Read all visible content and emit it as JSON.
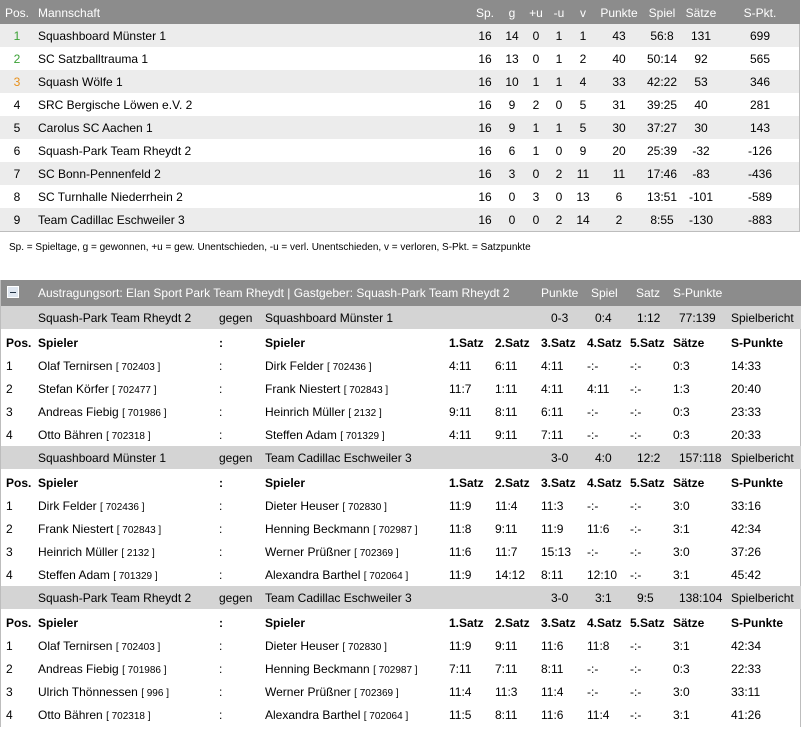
{
  "standings": {
    "headers": {
      "pos": "Pos.",
      "team": "Mannschaft",
      "sp": "Sp.",
      "g": "g",
      "pu": "+u",
      "mu": "-u",
      "v": "v",
      "punkte": "Punkte",
      "spiel": "Spiel",
      "saetze": "Sätze",
      "spkt": "S-Pkt."
    },
    "rows": [
      {
        "pos": "1",
        "team": "Squashboard Münster 1",
        "sp": "16",
        "g": "14",
        "pu": "0",
        "mu": "1",
        "v": "1",
        "punkte": "43",
        "spiel": "56:8",
        "saetze": "131",
        "spkt": "699"
      },
      {
        "pos": "2",
        "team": "SC Satzballtrauma 1",
        "sp": "16",
        "g": "13",
        "pu": "0",
        "mu": "1",
        "v": "2",
        "punkte": "40",
        "spiel": "50:14",
        "saetze": "92",
        "spkt": "565"
      },
      {
        "pos": "3",
        "team": "Squash Wölfe 1",
        "sp": "16",
        "g": "10",
        "pu": "1",
        "mu": "1",
        "v": "4",
        "punkte": "33",
        "spiel": "42:22",
        "saetze": "53",
        "spkt": "346"
      },
      {
        "pos": "4",
        "team": "SRC Bergische Löwen e.V. 2",
        "sp": "16",
        "g": "9",
        "pu": "2",
        "mu": "0",
        "v": "5",
        "punkte": "31",
        "spiel": "39:25",
        "saetze": "40",
        "spkt": "281"
      },
      {
        "pos": "5",
        "team": "Carolus SC Aachen 1",
        "sp": "16",
        "g": "9",
        "pu": "1",
        "mu": "1",
        "v": "5",
        "punkte": "30",
        "spiel": "37:27",
        "saetze": "30",
        "spkt": "143"
      },
      {
        "pos": "6",
        "team": "Squash-Park Team Rheydt 2",
        "sp": "16",
        "g": "6",
        "pu": "1",
        "mu": "0",
        "v": "9",
        "punkte": "20",
        "spiel": "25:39",
        "saetze": "-32",
        "spkt": "-126"
      },
      {
        "pos": "7",
        "team": "SC Bonn-Pennenfeld 2",
        "sp": "16",
        "g": "3",
        "pu": "0",
        "mu": "2",
        "v": "11",
        "punkte": "11",
        "spiel": "17:46",
        "saetze": "-83",
        "spkt": "-436"
      },
      {
        "pos": "8",
        "team": "SC Turnhalle Niederrhein 2",
        "sp": "16",
        "g": "0",
        "pu": "3",
        "mu": "0",
        "v": "13",
        "punkte": "6",
        "spiel": "13:51",
        "saetze": "-101",
        "spkt": "-589"
      },
      {
        "pos": "9",
        "team": "Team Cadillac Eschweiler 3",
        "sp": "16",
        "g": "0",
        "pu": "0",
        "mu": "2",
        "v": "14",
        "punkte": "2",
        "spiel": "8:55",
        "saetze": "-130",
        "spkt": "-883"
      }
    ]
  },
  "legend": "Sp. = Spieltage, g = gewonnen, +u = gew. Unentschieden, -u = verl. Unentschieden, v = verloren, S-Pkt. = Satzpunkte",
  "match_header": {
    "venue": "Austragungsort: Elan Sport Park Team Rheydt  |  Gastgeber: Squash-Park Team Rheydt 2",
    "punkte": "Punkte",
    "spiel": "Spiel",
    "satz": "Satz",
    "spunkte": "S-Punkte"
  },
  "games": [
    {
      "home": "Squash-Park Team Rheydt 2",
      "vs": "gegen",
      "away": "Squashboard Münster 1",
      "punkte": "0-3",
      "spiel": "0:4",
      "satz": "1:12",
      "spunkte": "77:139",
      "report": "Spielbericht",
      "cols": {
        "pos": "Pos.",
        "spieler1": "Spieler",
        "sep": ":",
        "spieler2": "Spieler",
        "s1": "1.Satz",
        "s2": "2.Satz",
        "s3": "3.Satz",
        "s4": "4.Satz",
        "s5": "5.Satz",
        "saetze": "Sätze",
        "spunkte": "S-Punkte"
      },
      "rows": [
        {
          "pos": "1",
          "p1": "Olaf Ternirsen",
          "l1": "[ 702403 ]",
          "sep": ":",
          "p2": "Dirk Felder",
          "l2": "[ 702436 ]",
          "s1": "4:11",
          "s2": "6:11",
          "s3": "4:11",
          "s4": "-:-",
          "s5": "-:-",
          "saetze": "0:3",
          "spunkte": "14:33"
        },
        {
          "pos": "2",
          "p1": "Stefan Körfer",
          "l1": "[ 702477 ]",
          "sep": ":",
          "p2": "Frank Niestert",
          "l2": "[ 702843 ]",
          "s1": "11:7",
          "s2": "1:11",
          "s3": "4:11",
          "s4": "4:11",
          "s5": "-:-",
          "saetze": "1:3",
          "spunkte": "20:40"
        },
        {
          "pos": "3",
          "p1": "Andreas Fiebig",
          "l1": "[ 701986 ]",
          "sep": ":",
          "p2": "Heinrich Müller",
          "l2": "[ 2132 ]",
          "s1": "9:11",
          "s2": "8:11",
          "s3": "6:11",
          "s4": "-:-",
          "s5": "-:-",
          "saetze": "0:3",
          "spunkte": "23:33"
        },
        {
          "pos": "4",
          "p1": "Otto Bähren",
          "l1": "[ 702318 ]",
          "sep": ":",
          "p2": "Steffen Adam",
          "l2": "[ 701329 ]",
          "s1": "4:11",
          "s2": "9:11",
          "s3": "7:11",
          "s4": "-:-",
          "s5": "-:-",
          "saetze": "0:3",
          "spunkte": "20:33"
        }
      ]
    },
    {
      "home": "Squashboard Münster 1",
      "vs": "gegen",
      "away": "Team Cadillac Eschweiler 3",
      "punkte": "3-0",
      "spiel": "4:0",
      "satz": "12:2",
      "spunkte": "157:118",
      "report": "Spielbericht",
      "cols": {
        "pos": "Pos.",
        "spieler1": "Spieler",
        "sep": ":",
        "spieler2": "Spieler",
        "s1": "1.Satz",
        "s2": "2.Satz",
        "s3": "3.Satz",
        "s4": "4.Satz",
        "s5": "5.Satz",
        "saetze": "Sätze",
        "spunkte": "S-Punkte"
      },
      "rows": [
        {
          "pos": "1",
          "p1": "Dirk Felder",
          "l1": "[ 702436 ]",
          "sep": ":",
          "p2": "Dieter Heuser",
          "l2": "[ 702830 ]",
          "s1": "11:9",
          "s2": "11:4",
          "s3": "11:3",
          "s4": "-:-",
          "s5": "-:-",
          "saetze": "3:0",
          "spunkte": "33:16"
        },
        {
          "pos": "2",
          "p1": "Frank Niestert",
          "l1": "[ 702843 ]",
          "sep": ":",
          "p2": "Henning Beckmann",
          "l2": "[ 702987 ]",
          "s1": "11:8",
          "s2": "9:11",
          "s3": "11:9",
          "s4": "11:6",
          "s5": "-:-",
          "saetze": "3:1",
          "spunkte": "42:34"
        },
        {
          "pos": "3",
          "p1": "Heinrich Müller",
          "l1": "[ 2132 ]",
          "sep": ":",
          "p2": "Werner Prüßner",
          "l2": "[ 702369 ]",
          "s1": "11:6",
          "s2": "11:7",
          "s3": "15:13",
          "s4": "-:-",
          "s5": "-:-",
          "saetze": "3:0",
          "spunkte": "37:26"
        },
        {
          "pos": "4",
          "p1": "Steffen Adam",
          "l1": "[ 701329 ]",
          "sep": ":",
          "p2": "Alexandra Barthel",
          "l2": "[ 702064 ]",
          "s1": "11:9",
          "s2": "14:12",
          "s3": "8:11",
          "s4": "12:10",
          "s5": "-:-",
          "saetze": "3:1",
          "spunkte": "45:42"
        }
      ]
    },
    {
      "home": "Squash-Park Team Rheydt 2",
      "vs": "gegen",
      "away": "Team Cadillac Eschweiler 3",
      "punkte": "3-0",
      "spiel": "3:1",
      "satz": "9:5",
      "spunkte": "138:104",
      "report": "Spielbericht",
      "cols": {
        "pos": "Pos.",
        "spieler1": "Spieler",
        "sep": ":",
        "spieler2": "Spieler",
        "s1": "1.Satz",
        "s2": "2.Satz",
        "s3": "3.Satz",
        "s4": "4.Satz",
        "s5": "5.Satz",
        "saetze": "Sätze",
        "spunkte": "S-Punkte"
      },
      "rows": [
        {
          "pos": "1",
          "p1": "Olaf Ternirsen",
          "l1": "[ 702403 ]",
          "sep": ":",
          "p2": "Dieter Heuser",
          "l2": "[ 702830 ]",
          "s1": "11:9",
          "s2": "9:11",
          "s3": "11:6",
          "s4": "11:8",
          "s5": "-:-",
          "saetze": "3:1",
          "spunkte": "42:34"
        },
        {
          "pos": "2",
          "p1": "Andreas Fiebig",
          "l1": "[ 701986 ]",
          "sep": ":",
          "p2": "Henning Beckmann",
          "l2": "[ 702987 ]",
          "s1": "7:11",
          "s2": "7:11",
          "s3": "8:11",
          "s4": "-:-",
          "s5": "-:-",
          "saetze": "0:3",
          "spunkte": "22:33"
        },
        {
          "pos": "3",
          "p1": "Ulrich Thönnessen",
          "l1": "[ 996 ]",
          "sep": ":",
          "p2": "Werner Prüßner",
          "l2": "[ 702369 ]",
          "s1": "11:4",
          "s2": "11:3",
          "s3": "11:4",
          "s4": "-:-",
          "s5": "-:-",
          "saetze": "3:0",
          "spunkte": "33:11"
        },
        {
          "pos": "4",
          "p1": "Otto Bähren",
          "l1": "[ 702318 ]",
          "sep": ":",
          "p2": "Alexandra Barthel",
          "l2": "[ 702064 ]",
          "s1": "11:5",
          "s2": "8:11",
          "s3": "11:6",
          "s4": "11:4",
          "s5": "-:-",
          "saetze": "3:1",
          "spunkte": "41:26"
        }
      ]
    }
  ]
}
